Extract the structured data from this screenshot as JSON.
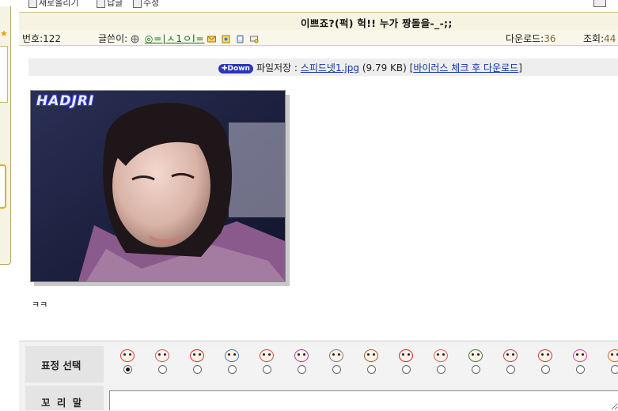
{
  "toolbar": {
    "item1": "새로올리기",
    "item2": "답글",
    "item3": "수정"
  },
  "post": {
    "title": "이쁘죠?(퍽) 헉!! 누가 짱돌을-_-;;",
    "number_label": "번호:",
    "number": "122",
    "author_label": "글쓴이:",
    "author_name": "◎=|ㅅ1ㅇl=",
    "downloads_label": "다운로드:",
    "downloads": "36",
    "views_label": "조회:",
    "views": "44",
    "body": "ㅋㅋ"
  },
  "file": {
    "badge": "Down",
    "label": "파일저장 :",
    "filename": "스피드넷1.jpg",
    "size": "(9.79 KB)",
    "virus_link": "바이러스 체크 후 다운로드"
  },
  "photo": {
    "logo_text": "HADJRI"
  },
  "emoticon": {
    "label": "표정 선택",
    "icons": [
      "angry-face-icon",
      "dizzy-face-icon",
      "kiss-face-icon",
      "crying-face-icon",
      "surprised-face-icon",
      "sweat-face-icon",
      "sleepy-face-icon",
      "devil-face-icon",
      "shock-face-icon",
      "tears-face-icon",
      "glasses-face-icon",
      "frown-face-icon",
      "pout-face-icon",
      "love-face-icon",
      "laugh-face-icon"
    ],
    "selected_index": 0
  },
  "tail": {
    "label": "꼬 리 말",
    "value": ""
  },
  "colors": {
    "title_bar": "#f6f3e2",
    "link": "#1133aa",
    "badge": "#2b35b8",
    "emoticon_table": "#f2f2f2"
  }
}
